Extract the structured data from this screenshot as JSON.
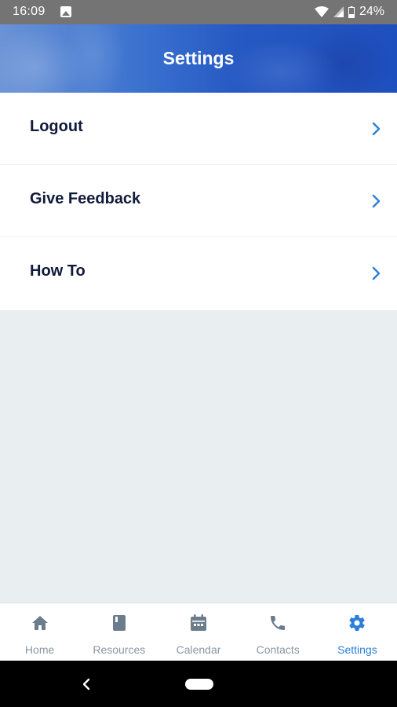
{
  "status_bar": {
    "time": "16:09",
    "battery": "24%",
    "icons": [
      "image-icon",
      "wifi-icon",
      "signal-icon",
      "battery-icon"
    ]
  },
  "header": {
    "title": "Settings"
  },
  "menu": {
    "items": [
      {
        "label": "Logout",
        "icon": "chevron-right-icon"
      },
      {
        "label": "Give Feedback",
        "icon": "chevron-right-icon"
      },
      {
        "label": "How To",
        "icon": "chevron-right-icon"
      }
    ]
  },
  "bottom_nav": {
    "items": [
      {
        "label": "Home",
        "icon": "home-icon",
        "active": false
      },
      {
        "label": "Resources",
        "icon": "book-icon",
        "active": false
      },
      {
        "label": "Calendar",
        "icon": "calendar-icon",
        "active": false
      },
      {
        "label": "Contacts",
        "icon": "phone-icon",
        "active": false
      },
      {
        "label": "Settings",
        "icon": "gear-icon",
        "active": true
      }
    ]
  },
  "colors": {
    "accent": "#2b7fd9",
    "inactive": "#8a97a4",
    "menu_text": "#101a3a",
    "background": "#e9eef1",
    "header": "#2659c3"
  }
}
